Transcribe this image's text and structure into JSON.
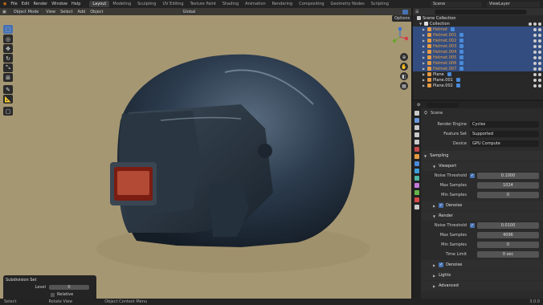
{
  "topbar": {
    "menu": [
      "File",
      "Edit",
      "Render",
      "Window",
      "Help"
    ],
    "workspaces": [
      "Layout",
      "Modeling",
      "Sculpting",
      "UV Editing",
      "Texture Paint",
      "Shading",
      "Animation",
      "Rendering",
      "Compositing",
      "Geometry Nodes",
      "Scripting"
    ],
    "active_workspace": "Layout",
    "scene": "Scene",
    "view_layer": "ViewLayer"
  },
  "viewport": {
    "mode": "Object Mode",
    "menus": [
      "View",
      "Select",
      "Add",
      "Object"
    ],
    "orientation": "Global",
    "options": "Options"
  },
  "redo_panel": {
    "title": "Subdivision Set",
    "level_label": "Level",
    "level_value": "0",
    "relative_label": "Relative"
  },
  "statusbar": {
    "select": "Select",
    "rotate": "Rotate View",
    "context": "Object Context Menu",
    "version": "3.0.0"
  },
  "outliner": {
    "title": "Scene Collection",
    "collection": "Collection",
    "items": [
      {
        "name": "Helmet",
        "selected": true,
        "color": "orange"
      },
      {
        "name": "Helmet.001",
        "selected": true,
        "color": "orange"
      },
      {
        "name": "Helmet.002",
        "selected": true,
        "color": "orange"
      },
      {
        "name": "Helmet.003",
        "selected": true,
        "color": "orange"
      },
      {
        "name": "Helmet.004",
        "selected": true,
        "color": "orange"
      },
      {
        "name": "Helmet.005",
        "selected": true,
        "color": "orange"
      },
      {
        "name": "Helmet.006",
        "selected": true,
        "color": "orange"
      },
      {
        "name": "Helmet.007",
        "selected": true,
        "color": "orange"
      },
      {
        "name": "Plane",
        "selected": false,
        "color": "white"
      },
      {
        "name": "Plane.001",
        "selected": false,
        "color": "white"
      },
      {
        "name": "Plane.002",
        "selected": false,
        "color": "white"
      }
    ]
  },
  "properties": {
    "scene_name": "Scene",
    "render_engine_label": "Render Engine",
    "render_engine": "Cycles",
    "feature_set_label": "Feature Set",
    "feature_set": "Supported",
    "device_label": "Device",
    "device": "GPU Compute",
    "sampling": "Sampling",
    "viewport": "Viewport",
    "vp_noise_label": "Noise Threshold",
    "vp_noise": "0.1000",
    "vp_max_label": "Max Samples",
    "vp_max": "1024",
    "vp_min_label": "Min Samples",
    "vp_min": "0",
    "denoise": "Denoise",
    "render": "Render",
    "r_noise_label": "Noise Threshold",
    "r_noise": "0.0100",
    "r_max_label": "Max Samples",
    "r_max": "4096",
    "r_min_label": "Min Samples",
    "r_min": "0",
    "time_label": "Time Limit",
    "time": "0 sec",
    "r_denoise": "Denoise",
    "lights": "Lights",
    "advanced": "Advanced"
  }
}
